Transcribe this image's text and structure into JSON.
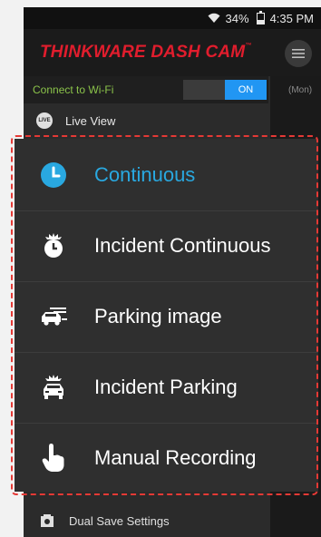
{
  "status_bar": {
    "battery_text": "34%",
    "battery_level": 0.34,
    "time": "4:35 PM"
  },
  "app_bar": {
    "title": "THINKWARE DASH CAM",
    "trademark": "™"
  },
  "wifi": {
    "label": "Connect to Wi-Fi",
    "toggle_label": "ON"
  },
  "side_panel": {
    "day_label": "(Mon)"
  },
  "live_view": {
    "icon_text": "LIVE",
    "label": "Live View"
  },
  "recording_menu": {
    "items": [
      {
        "label": "Continuous",
        "icon": "clock-icon",
        "selected": true
      },
      {
        "label": "Incident Continuous",
        "icon": "alarm-clock-icon",
        "selected": false
      },
      {
        "label": "Parking image",
        "icon": "parked-car-icon",
        "selected": false
      },
      {
        "label": "Incident Parking",
        "icon": "car-crash-icon",
        "selected": false
      },
      {
        "label": "Manual Recording",
        "icon": "hand-pointer-icon",
        "selected": false
      }
    ]
  },
  "bottom_item": {
    "label": "Dual Save Settings",
    "icon": "dual-save-icon"
  },
  "colors": {
    "accent": "#29a8e0",
    "brand": "#e11d2d",
    "toggle_on": "#2196f3",
    "wifi_label": "#8bc34a",
    "highlight_border": "#e53935"
  }
}
